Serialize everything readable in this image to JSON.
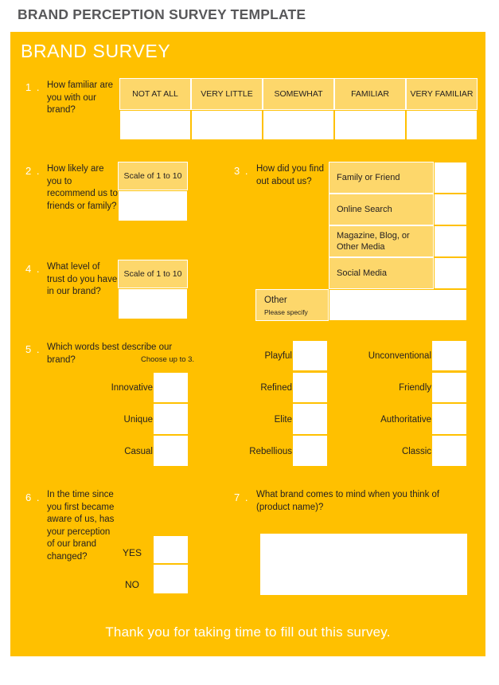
{
  "document": {
    "title": "BRAND PERCEPTION SURVEY TEMPLATE"
  },
  "panel": {
    "heading": "BRAND SURVEY",
    "footer": "Thank you for taking time to fill out this survey.",
    "accent_color": "#FFC000",
    "header_cell_color": "#FDD76B",
    "text_color": "#231f20",
    "heading_color": "#ffffff"
  },
  "questions": [
    {
      "number": "1 .",
      "text": "How familiar are you with our brand?",
      "type": "scale-row",
      "columns": [
        "NOT AT ALL",
        "VERY LITTLE",
        "SOMEWHAT",
        "FAMILIAR",
        "VERY FAMILIAR"
      ],
      "answers": [
        "",
        "",
        "",
        "",
        ""
      ]
    },
    {
      "number": "2 .",
      "text": "How likely are you to recommend us to friends or family?",
      "type": "scale-box",
      "scale_label": "Scale of 1 to 10",
      "answer": ""
    },
    {
      "number": "3 .",
      "text": "How did you find out about us?",
      "type": "option-list",
      "options": [
        "Family or Friend",
        "Online Search",
        "Magazine, Blog, or Other Media",
        "Social Media"
      ],
      "answers": [
        "",
        "",
        "",
        ""
      ],
      "other_label": "Other",
      "other_sub": "Please specify",
      "other_answer": ""
    },
    {
      "number": "4 .",
      "text": "What level of trust do you have in our brand?",
      "type": "scale-box",
      "scale_label": "Scale of 1 to 10",
      "answer": ""
    },
    {
      "number": "5 .",
      "text": "Which words best describe our brand?",
      "sub_text": "Choose up to 3.",
      "type": "word-grid",
      "columns": [
        [
          "Innovative",
          "Unique",
          "Casual"
        ],
        [
          "Playful",
          "Refined",
          "Elite",
          "Rebellious"
        ],
        [
          "Unconventional",
          "Friendly",
          "Authoritative",
          "Classic"
        ]
      ],
      "answers": [
        [
          "",
          "",
          ""
        ],
        [
          "",
          "",
          "",
          ""
        ],
        [
          "",
          "",
          "",
          ""
        ]
      ]
    },
    {
      "number": "6 .",
      "text": "In the time since you first became aware of us, has your perception of our brand changed?",
      "type": "yes-no",
      "yes_label": "YES",
      "no_label": "NO",
      "yes_answer": "",
      "no_answer": ""
    },
    {
      "number": "7 .",
      "text": "What brand comes to mind when you think of (product name)?",
      "type": "free-text",
      "answer": ""
    }
  ]
}
